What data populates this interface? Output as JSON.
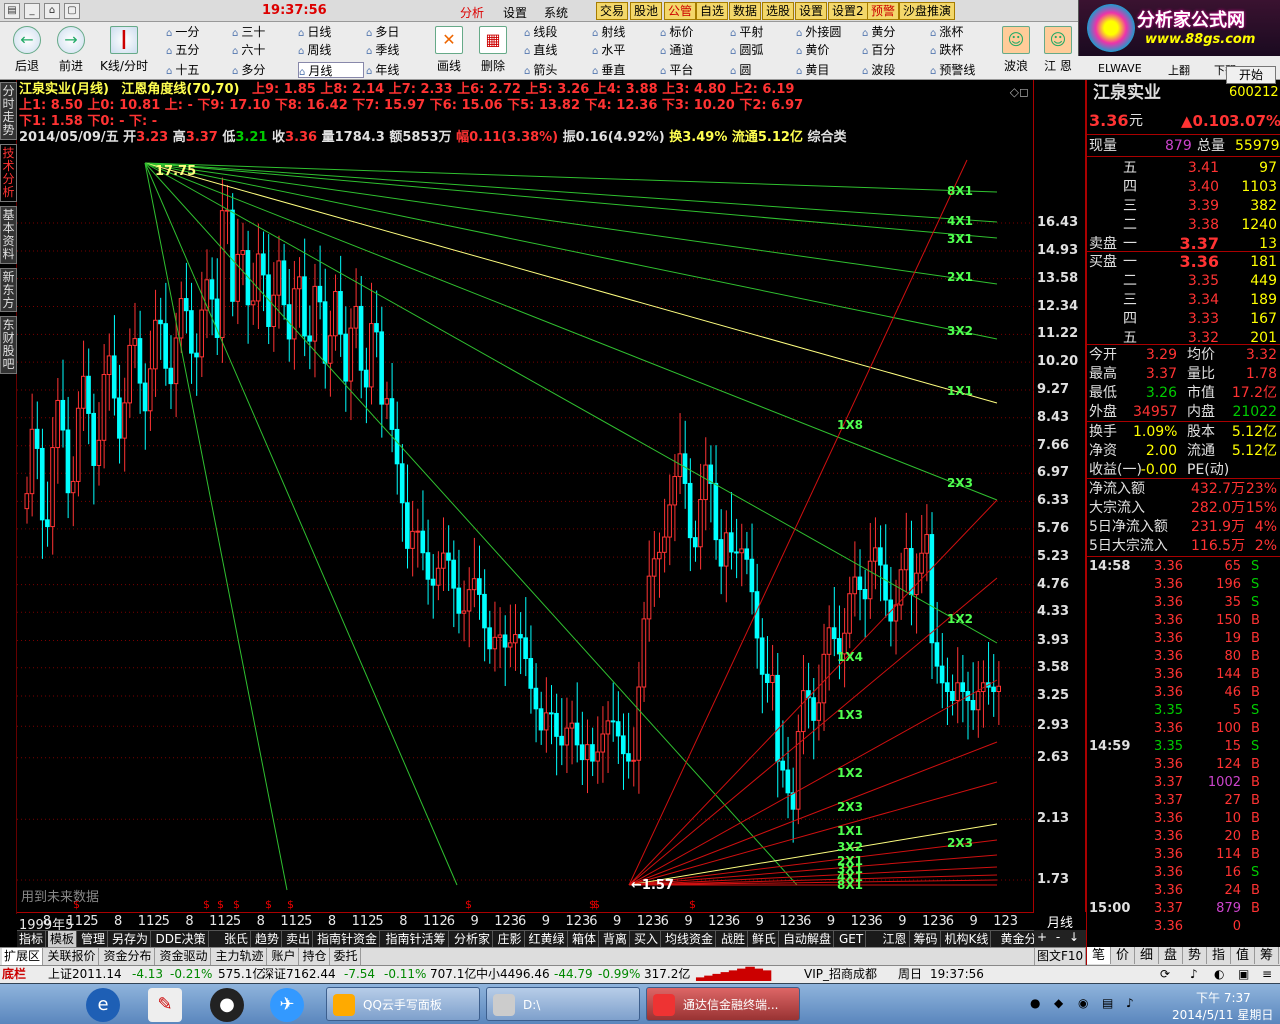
{
  "topbar": {
    "clock": "19:37:56",
    "menus": [
      "分析",
      "设置",
      "系统"
    ],
    "yellow_buttons": [
      "交易",
      "股池",
      "公管",
      "自选",
      "数据",
      "选股",
      "设置",
      "设置2",
      "预警",
      "沙盘推演"
    ]
  },
  "toolbar": {
    "big_buttons": [
      "后退",
      "前进",
      "K线/分时",
      "画线",
      "删除",
      "波浪",
      "江 恩",
      "ELWAVE",
      "上翻",
      "下翻"
    ],
    "periods": [
      "一分",
      "五分",
      "十五",
      "三十",
      "六十",
      "多分",
      "日线",
      "周线",
      "月线",
      "多日",
      "季线",
      "年线"
    ],
    "drawtools": [
      "线段",
      "直线",
      "箭头",
      "射线",
      "水平",
      "垂直",
      "标价",
      "通道",
      "平台",
      "平射",
      "圆弧",
      "圆",
      "外接圆",
      "黄价",
      "黄目",
      "黄分",
      "百分",
      "波段",
      "涨杯",
      "跌杯",
      "预警线"
    ],
    "start_label": "开始"
  },
  "logo": {
    "title": "分析家公式网",
    "url": "www.88gs.com"
  },
  "vtabs": [
    "分时走势",
    "技术分析",
    "基本资料",
    "新东方",
    "东财股吧"
  ],
  "chart": {
    "title_name": "江泉实业(月线)",
    "indicator": "江恩角度线(70,70)",
    "line1": "上9: 1.85 上8: 2.14 上7: 2.33 上6: 2.72 上5: 3.26 上4: 3.88 上3: 4.80 上2: 6.19",
    "line2": "上1: 8.50 上0: 10.81 上: - 下9: 17.10 下8: 16.42 下7: 15.97 下6: 15.06 下5: 13.82 下4: 12.36 下3: 10.20 下2: 6.97",
    "line3": "下1: 1.58 下0: - 下: -",
    "bar_date": "2014/05/09/五",
    "bar_open_label": "开",
    "bar_open": "3.23",
    "bar_high_label": "高",
    "bar_high": "3.37",
    "bar_low_label": "低",
    "bar_low": "3.21",
    "bar_close_label": "收",
    "bar_close": "3.36",
    "bar_vol": "量1784.3",
    "bar_amt": "额5853万",
    "bar_chg": "幅0.11(3.38%)",
    "bar_amp": "振0.16(4.92%)",
    "bar_turn": "换3.49%",
    "bar_float": "流通5.12亿",
    "bar_cat": "综合类",
    "high_label": "17.75",
    "low_label": "1.57",
    "future_note": "用到未来数据",
    "gann_upper": [
      "8X1",
      "4X1",
      "3X1",
      "2X1",
      "3X2",
      "1X1",
      "1X8",
      "2X3",
      "1X2"
    ],
    "gann_lower": [
      "1X4",
      "1X3",
      "1X2",
      "2X3",
      "1X1",
      "3X2",
      "2X1",
      "3X1",
      "4X1",
      "8X1"
    ],
    "y_labels": [
      "16.43",
      "14.93",
      "13.58",
      "12.34",
      "11.22",
      "10.20",
      "9.27",
      "8.43",
      "7.66",
      "6.97",
      "6.33",
      "5.76",
      "5.23",
      "4.76",
      "4.33",
      "3.93",
      "3.58",
      "3.25",
      "2.93",
      "2.63",
      "2.13",
      "1.73"
    ],
    "x_labels": [
      "1999年5",
      "8",
      "112",
      "5",
      "8",
      "112",
      "5",
      "8",
      "112",
      "5",
      "8",
      "112",
      "5",
      "8",
      "112",
      "5",
      "8",
      "112",
      "6",
      "9",
      "123",
      "6",
      "9",
      "123",
      "6",
      "9",
      "123",
      "6",
      "9",
      "123",
      "6",
      "9",
      "123",
      "6",
      "9",
      "123",
      "6",
      "9",
      "123",
      "6",
      "9",
      "123"
    ],
    "period_label": "月线"
  },
  "tabbar1": [
    "指标",
    "模板",
    "管理",
    "另存为",
    "DDE决策",
    "张氏",
    "趋势",
    "卖出",
    "指南针资金",
    "指南针活筹",
    "分析家",
    "庄影",
    "红黄绿",
    "箱体",
    "背离",
    "买入",
    "均线资金",
    "战胜",
    "鲜氏",
    "自动解盘",
    "GET",
    "江恩",
    "筹码",
    "机构K线",
    "黄金分割"
  ],
  "tabbar2": [
    "扩展区",
    "关联报价",
    "资金分布",
    "资金驱动",
    "主力轨迹",
    "账户",
    "持仓",
    "委托"
  ],
  "tabbar2_right": "图文F10",
  "rpanel": {
    "name": "江泉实业",
    "code": "600212",
    "price": "3.36",
    "price_unit": "元",
    "change": "▲0.10",
    "pct": "3.07%",
    "now_vol_label": "现量",
    "now_vol": "879",
    "total_vol_label": "总量",
    "total_vol": "55979",
    "sell": [
      {
        "lvl": "五",
        "price": "3.41",
        "vol": "97"
      },
      {
        "lvl": "四",
        "price": "3.40",
        "vol": "1103"
      },
      {
        "lvl": "三",
        "price": "3.39",
        "vol": "382"
      },
      {
        "lvl": "二",
        "price": "3.38",
        "vol": "1240"
      },
      {
        "lvl": "一",
        "price": "3.37",
        "vol": "13"
      }
    ],
    "sell_label": "卖盘",
    "buy_label": "买盘",
    "buy": [
      {
        "lvl": "一",
        "price": "3.36",
        "vol": "181"
      },
      {
        "lvl": "二",
        "price": "3.35",
        "vol": "449"
      },
      {
        "lvl": "三",
        "price": "3.34",
        "vol": "189"
      },
      {
        "lvl": "四",
        "price": "3.33",
        "vol": "167"
      },
      {
        "lvl": "五",
        "price": "3.32",
        "vol": "201"
      }
    ],
    "stats": [
      {
        "l1": "今开",
        "v1": "3.29",
        "l2": "均价",
        "v2": "3.32"
      },
      {
        "l1": "最高",
        "v1": "3.37",
        "l2": "量比",
        "v2": "1.78"
      },
      {
        "l1": "最低",
        "v1": "3.26",
        "l2": "市值",
        "v2": "17.2亿"
      },
      {
        "l1": "外盘",
        "v1": "34957",
        "l2": "内盘",
        "v2": "21022"
      }
    ],
    "fund": [
      {
        "l1": "换手",
        "v1": "1.09%",
        "l2": "股本",
        "v2": "5.12亿"
      },
      {
        "l1": "净资",
        "v1": "2.00",
        "l2": "流通",
        "v2": "5.12亿"
      },
      {
        "l1": "收益(一)",
        "v1": "-0.00",
        "l2": "PE(动)",
        "v2": ""
      }
    ],
    "flow": [
      {
        "l": "净流入额",
        "v": "432.7万",
        "p": "23%"
      },
      {
        "l": "大宗流入",
        "v": "282.0万",
        "p": "15%"
      },
      {
        "l": "5日净流入额",
        "v": "231.9万",
        "p": "4%"
      },
      {
        "l": "5日大宗流入",
        "v": "116.5万",
        "p": "2%"
      }
    ],
    "ticks": [
      {
        "t": "14:58",
        "p": "3.36",
        "v": "65",
        "s": "S"
      },
      {
        "t": "",
        "p": "3.36",
        "v": "196",
        "s": "S"
      },
      {
        "t": "",
        "p": "3.36",
        "v": "35",
        "s": "S"
      },
      {
        "t": "",
        "p": "3.36",
        "v": "150",
        "s": "B"
      },
      {
        "t": "",
        "p": "3.36",
        "v": "19",
        "s": "B"
      },
      {
        "t": "",
        "p": "3.36",
        "v": "80",
        "s": "B"
      },
      {
        "t": "",
        "p": "3.36",
        "v": "144",
        "s": "B"
      },
      {
        "t": "",
        "p": "3.36",
        "v": "46",
        "s": "B"
      },
      {
        "t": "",
        "p": "3.35",
        "v": "5",
        "s": "S"
      },
      {
        "t": "",
        "p": "3.36",
        "v": "100",
        "s": "B"
      },
      {
        "t": "14:59",
        "p": "3.35",
        "v": "15",
        "s": "S"
      },
      {
        "t": "",
        "p": "3.36",
        "v": "124",
        "s": "B"
      },
      {
        "t": "",
        "p": "3.37",
        "v": "1002",
        "s": "B"
      },
      {
        "t": "",
        "p": "3.37",
        "v": "27",
        "s": "B"
      },
      {
        "t": "",
        "p": "3.36",
        "v": "10",
        "s": "B"
      },
      {
        "t": "",
        "p": "3.36",
        "v": "20",
        "s": "B"
      },
      {
        "t": "",
        "p": "3.36",
        "v": "114",
        "s": "B"
      },
      {
        "t": "",
        "p": "3.36",
        "v": "16",
        "s": "S"
      },
      {
        "t": "",
        "p": "3.36",
        "v": "24",
        "s": "B"
      },
      {
        "t": "15:00",
        "p": "3.37",
        "v": "879",
        "s": "B"
      },
      {
        "t": "",
        "p": "3.36",
        "v": "0",
        "s": ""
      }
    ],
    "tabs": [
      "笔",
      "价",
      "细",
      "盘",
      "势",
      "指",
      "值",
      "筹"
    ]
  },
  "status": {
    "label": "底栏",
    "sh": "上证2011.14",
    "sh_chg": "-4.13",
    "sh_pct": "-0.21%",
    "sh_amt": "575.1亿",
    "sz": "深证7162.44",
    "sz_chg": "-7.54",
    "sz_pct": "-0.11%",
    "sz_amt": "707.1亿",
    "zx": "中小4496.46",
    "zx_chg": "-44.79",
    "zx_pct": "-0.99%",
    "zx_amt": "317.2亿",
    "broker": "VIP_招商成都",
    "day": "周日",
    "time": "19:37:56"
  },
  "taskbar": {
    "tasks": [
      "QQ云手写面板",
      "D:\\",
      "通达信金融终端..."
    ],
    "clock": "下午 7:37",
    "date": "2014/5/11 星期日"
  },
  "colors": {
    "up": "#ff3333",
    "down": "#00ffff",
    "gann_green": "#30c030",
    "gann_red": "#d01010",
    "gann_yellow": "#ffff80"
  }
}
